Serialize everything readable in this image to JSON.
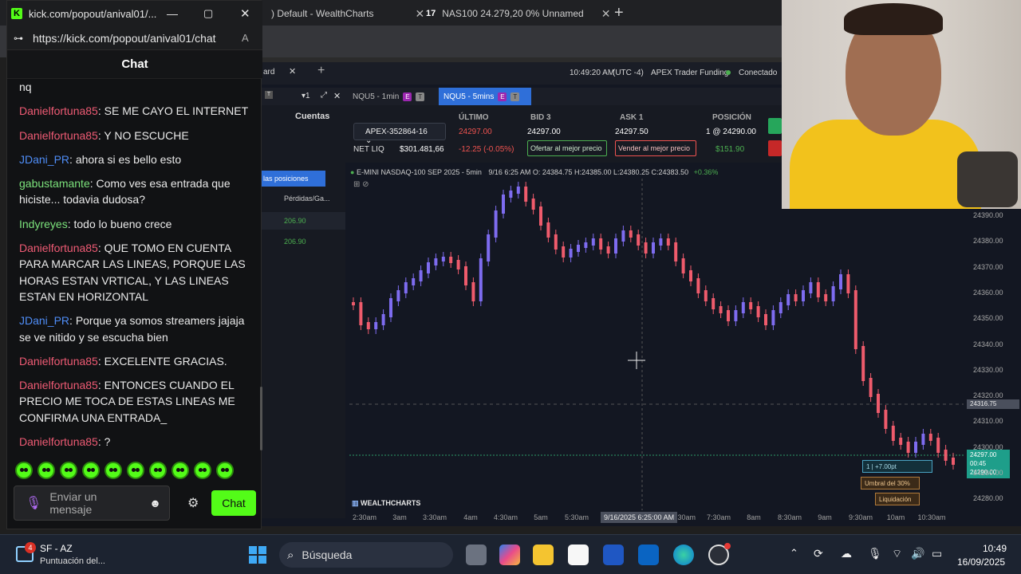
{
  "browser": {
    "tabs": [
      {
        "label": ") Default - WealthCharts"
      },
      {
        "label": "NAS100 24.279,20 0% Unnamed"
      }
    ]
  },
  "kick": {
    "window_title": "kick.com/popout/anival01/...",
    "url": "https://kick.com/popout/anival01/chat",
    "chat_title": "Chat",
    "messages": [
      {
        "user": "",
        "text": "nq",
        "color": "plain"
      },
      {
        "user": "Danielfortuna85",
        "text": "SE ME CAYO EL INTERNET",
        "color": "red"
      },
      {
        "user": "Danielfortuna85",
        "text": "Y NO ESCUCHE",
        "color": "red"
      },
      {
        "user": "JDani_PR",
        "text": "ahora si es bello esto",
        "color": "blue"
      },
      {
        "user": "gabustamante",
        "text": "Como ves esa entrada que hiciste... todavia dudosa?",
        "color": "green"
      },
      {
        "user": "Indyreyes",
        "text": "todo lo bueno crece",
        "color": "green"
      },
      {
        "user": "Danielfortuna85",
        "text": "QUE TOMO EN CUENTA PARA MARCAR LAS LINEAS, PORQUE LAS HORAS ESTAN VRTICAL, Y LAS LINEAS ESTAN EN HORIZONTAL",
        "color": "red"
      },
      {
        "user": "JDani_PR",
        "text": "Porque ya somos streamers jajaja se ve nitido y se escucha bien",
        "color": "blue"
      },
      {
        "user": "Danielfortuna85",
        "text": "EXCELENTE GRACIAS.",
        "color": "red"
      },
      {
        "user": "Danielfortuna85",
        "text": "ENTONCES CUANDO EL PRECIO ME TOCA DE ESTAS LINEAS ME CONFIRMA UNA ENTRADA_",
        "color": "red"
      },
      {
        "user": "Danielfortuna85",
        "text": "?",
        "color": "red"
      }
    ],
    "input_placeholder": "Enviar un mensaje",
    "send_label": "Chat"
  },
  "wealthcharts": {
    "top_tab": "ard",
    "time": "10:49:20 AM",
    "timezone": "(UTC -4)",
    "account_firm": "APEX Trader Funding",
    "status": "Conectado",
    "chart_tabs": [
      "NQU5 - 1min",
      "NQU5 - 5mins"
    ],
    "tab_badges": [
      "E",
      "T"
    ],
    "cuentas_label": "Cuentas",
    "account_id": "APEX-352864-16",
    "net_liq_label": "NET LIQ",
    "net_liq_value": "$301.481,66",
    "ultimo_label": "ÚLTIMO",
    "ultimo_value": "24297.00",
    "ultimo_change": "-12.25 (-0.05%)",
    "bid_label": "BID 3",
    "bid_value": "24297.00",
    "ask_label": "ASK 1",
    "ask_value": "24297.50",
    "posicion_label": "POSICIÓN",
    "posicion_value": "1 @ 24290.00",
    "pnl": "$151.90",
    "buy_btn": "Ofertar al mejor precio",
    "sell_btn": "Vender al mejor precio",
    "positions_tab": "las posiciones",
    "positions_col": "Pérdidas/Ga...",
    "positions_rows": [
      "206.90",
      "206.90"
    ],
    "chart_header": "E-MINI NASDAQ-100 SEP 2025 - 5min",
    "chart_ohlc": "9/16 6:25 AM O: 24384.75 H:24385.00 L:24380.25 C:24383.50",
    "chart_change": "+0.36%",
    "logo": "WEALTHCHARTS",
    "crosshair_time": "9/16/2025 6:25:00 AM",
    "crosshair_price": "24316.75",
    "price_ticks": [
      "24390.00",
      "24380.00",
      "24370.00",
      "24360.00",
      "24350.00",
      "24340.00",
      "24330.00",
      "24320.00",
      "24310.00",
      "24300.00",
      "24290.00",
      "24280.00"
    ],
    "price_last": "24297.00",
    "price_timer": "00:45",
    "price_entry": "24290.00",
    "time_ticks": [
      "2:30am",
      "3am",
      "3:30am",
      "4am",
      "4:30am",
      "5am",
      "5:30am",
      "6:30am",
      "7:30am",
      "8am",
      "8:30am",
      "9am",
      "9:30am",
      "10am",
      "10:30am"
    ],
    "order_label": "1 | +7.00pt",
    "umbral_label": "Umbral del 30%",
    "liquidacion_label": "Liquidación"
  },
  "taskbar": {
    "weather_badge": "4",
    "weather_title": "SF - AZ",
    "weather_sub": "Puntuación del...",
    "search_label": "Búsqueda",
    "clock_time": "10:49",
    "clock_date": "16/09/2025"
  }
}
